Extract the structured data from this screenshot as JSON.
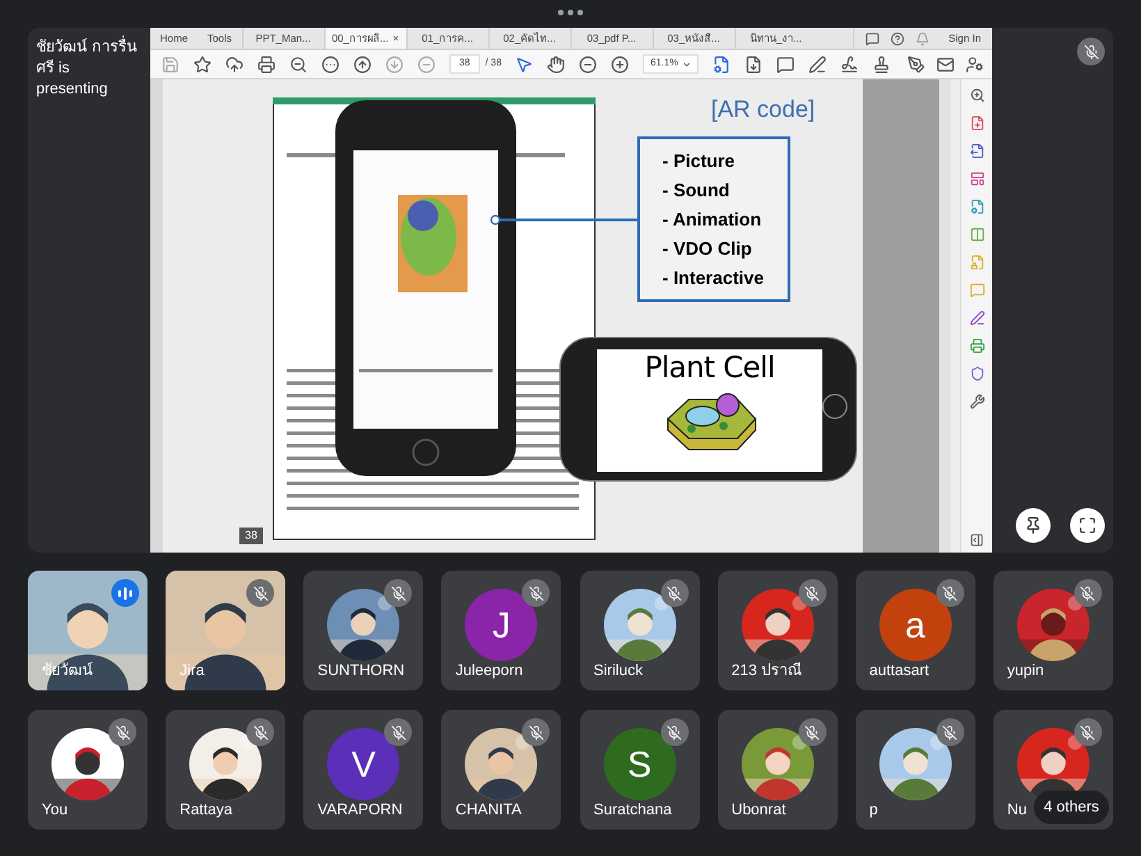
{
  "stage": {
    "presenting_label": "ชัยวัฒน์ การรื่นศรี is presenting",
    "muted": true
  },
  "acrobat": {
    "menu": [
      "Home",
      "Tools"
    ],
    "tabs": [
      {
        "label": "PPT_Man...",
        "selected": false
      },
      {
        "label": "00_การผลิ...",
        "selected": true
      },
      {
        "label": "01_การค...",
        "selected": false
      },
      {
        "label": "02_คัดไท...",
        "selected": false
      },
      {
        "label": "03_pdf P...",
        "selected": false
      },
      {
        "label": "03_หนังสื...",
        "selected": false
      },
      {
        "label": "นิทาน_งา...",
        "selected": false
      }
    ],
    "tab_close": "×",
    "sign_in": "Sign In",
    "page_field": "38",
    "page_total": "/ 38",
    "zoom": "61.1%",
    "page_badge": "38"
  },
  "slide": {
    "heading": "[AR code]",
    "features": [
      "- Picture",
      "- Sound",
      "- Animation",
      "- VDO Clip",
      "- Interactive"
    ],
    "phone_title": "Plant Cell"
  },
  "participants": [
    {
      "name": "ชัยวัฒน์",
      "kind": "video",
      "muted": false,
      "speaking": true
    },
    {
      "name": "Jira",
      "kind": "video",
      "muted": true,
      "speaking": false
    },
    {
      "name": "SUNTHORN",
      "muted": true,
      "speaking": false
    },
    {
      "name": "Juleeporn",
      "kind": "letter",
      "letter": "J",
      "color": "#8a24a8",
      "muted": true,
      "speaking": false
    },
    {
      "name": "Siriluck",
      "muted": true,
      "speaking": false
    },
    {
      "name": "213 ปราณี",
      "muted": true,
      "speaking": false
    },
    {
      "name": "auttasart",
      "kind": "letter",
      "letter": "a",
      "color": "#c2410c",
      "muted": true,
      "speaking": false
    },
    {
      "name": "yupin",
      "muted": true,
      "speaking": false
    },
    {
      "name": "You",
      "muted": true,
      "speaking": false
    },
    {
      "name": "Rattaya",
      "muted": true,
      "speaking": false
    },
    {
      "name": "VARAPORN",
      "kind": "letter",
      "letter": "V",
      "color": "#5b2fb8",
      "muted": true,
      "speaking": false
    },
    {
      "name": "CHANITA",
      "muted": true,
      "speaking": false
    },
    {
      "name": "Suratchana",
      "kind": "letter",
      "letter": "S",
      "color": "#2e6b1f",
      "muted": true,
      "speaking": false
    },
    {
      "name": "Ubonrat",
      "muted": true,
      "speaking": false
    },
    {
      "name": "p",
      "muted": true,
      "speaking": false
    },
    {
      "name": "Nu",
      "muted": true,
      "speaking": false
    }
  ],
  "others_chip": "4 others"
}
